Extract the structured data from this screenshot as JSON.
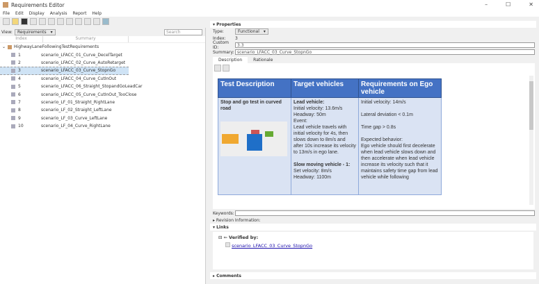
{
  "window": {
    "title": "Requirements Editor"
  },
  "menu": [
    "File",
    "Edit",
    "Display",
    "Analysis",
    "Report",
    "Help"
  ],
  "view": {
    "label": "View:",
    "selected": "Requirements",
    "search_placeholder": "Search"
  },
  "columns": {
    "index": "Index",
    "summary": "Summary"
  },
  "tree": {
    "root": "HighwayLaneFollowingTestRequirements",
    "items": [
      {
        "index": "1",
        "summary": "scenario_LFACC_01_Curve_DecelTarget"
      },
      {
        "index": "2",
        "summary": "scenario_LFACC_02_Curve_AutoRetarget"
      },
      {
        "index": "3",
        "summary": "scenario_LFACC_03_Curve_StopnGo"
      },
      {
        "index": "4",
        "summary": "scenario_LFACC_04_Curve_CutInOut"
      },
      {
        "index": "5",
        "summary": "scenario_LFACC_06_Straight_StopandGoLeadCar"
      },
      {
        "index": "6",
        "summary": "scenario_LFACC_05_Curve_CutInOut_TooClose"
      },
      {
        "index": "7",
        "summary": "scenario_LF_01_Straight_RightLane"
      },
      {
        "index": "8",
        "summary": "scenario_LF_02_Straight_LeftLane"
      },
      {
        "index": "9",
        "summary": "scenario_LF_03_Curve_LeftLane"
      },
      {
        "index": "10",
        "summary": "scenario_LF_04_Curve_RightLane"
      }
    ]
  },
  "properties": {
    "header": "Properties",
    "type_label": "Type:",
    "type": "Functional",
    "index_label": "Index:",
    "index": "3",
    "custom_id_label": "Custom ID:",
    "custom_id": "3.3",
    "summary_label": "Summary:",
    "summary": "scenario_LFACC_03_Curve_StopnGo",
    "tabs": [
      "Description",
      "Rationale"
    ],
    "keywords_label": "Keywords:",
    "revision_label": "Revision Information:"
  },
  "table": {
    "headers": [
      "Test Description",
      "Target vehicles",
      "Requirements on Ego vehicle"
    ],
    "col1_title": "Stop and go test in curved road",
    "col2": {
      "lead_title": "Lead vehicle:",
      "lead": [
        "Initial velocity: 13.6m/s",
        "Headway: 50m",
        "Event:",
        "Lead vehicle travels with initial velocity for 4s, then slows down to 8m/s and after 10s increase its velocity to 13m/s in ego lane."
      ],
      "slow_title": "Slow moving vehicle - 1:",
      "slow": [
        "Set velocity: 8m/s",
        "Headway: 1100m"
      ]
    },
    "col3": [
      "Initial velocity: 14m/s",
      "Lateral deviation < 0.1m",
      "Time gap > 0.8s",
      "Expected behavior:",
      "Ego vehicle should first decelerate when lead vehicle slows down and then accelerate when lead vehicle increase its velocity such that it maintains safety time gap from lead vehicle while following"
    ]
  },
  "links": {
    "header": "Links",
    "verified_by": "Verified by:",
    "link": "scenario_LFACC_03_Curve_StopnGo"
  },
  "comments": {
    "header": "Comments"
  }
}
